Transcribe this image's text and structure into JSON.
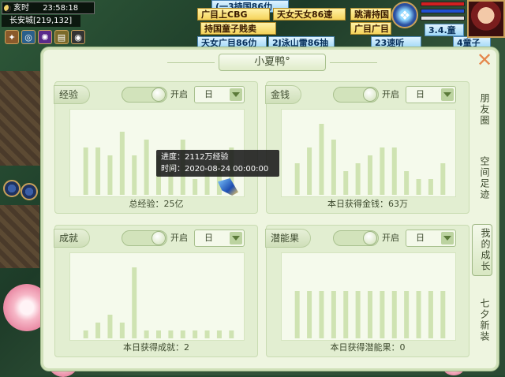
{
  "hud": {
    "time_label": "亥时",
    "clock": "23:58:18",
    "city": "长安城[219,132]"
  },
  "tickers": [
    {
      "text": "(一3持国86仂",
      "style": "blue"
    },
    {
      "text": "广目上CBG",
      "style": "yellow"
    },
    {
      "text": "天女天女86速",
      "style": "yellow"
    },
    {
      "text": "跳清持国",
      "style": "yellow"
    },
    {
      "text": "持国童子贱卖",
      "style": "yellow"
    },
    {
      "text": "广目广目",
      "style": "yellow"
    },
    {
      "text": "天女广目86仂",
      "style": "blue"
    },
    {
      "text": "2J泳山雷86抽",
      "style": "blue"
    },
    {
      "text": "23速听",
      "style": "blue"
    },
    {
      "text": "3.4.童",
      "style": "blue"
    },
    {
      "text": "4童子",
      "style": "blue"
    }
  ],
  "panel": {
    "title": "小夏鸭°",
    "close_label": "✕"
  },
  "side_tabs": [
    {
      "label": "朋友圈",
      "active": false
    },
    {
      "label": "空间足迹",
      "active": false
    },
    {
      "label": "我的成长",
      "active": true
    },
    {
      "label": "七夕新装",
      "active": false
    }
  ],
  "cards": {
    "exp": {
      "tab": "经验",
      "toggle": "开启",
      "period": "日",
      "footer": "总经验：25亿"
    },
    "money": {
      "tab": "金钱",
      "toggle": "开启",
      "period": "日",
      "footer": "本日获得金钱：63万"
    },
    "achievement": {
      "tab": "成就",
      "toggle": "开启",
      "period": "日",
      "footer": "本日获得成就：2"
    },
    "potential": {
      "tab": "潜能果",
      "toggle": "开启",
      "period": "日",
      "footer": "本日获得潜能果：0"
    }
  },
  "tooltip": {
    "line1": "进度：2112万经验",
    "line2": "时间：2020-08-24  00:00:00"
  },
  "chart_data": [
    {
      "id": "exp",
      "type": "bar",
      "values": [
        6,
        6,
        5,
        8,
        5,
        7,
        5,
        4,
        7,
        2,
        3,
        4,
        6
      ]
    },
    {
      "id": "money",
      "type": "bar",
      "values": [
        4,
        6,
        9,
        7,
        3,
        4,
        5,
        6,
        6,
        3,
        2,
        2,
        4
      ]
    },
    {
      "id": "achievement",
      "type": "bar",
      "values": [
        1,
        2,
        3,
        2,
        9,
        1,
        1,
        1,
        1,
        1,
        1,
        1,
        1
      ]
    },
    {
      "id": "potential",
      "type": "bar",
      "values": [
        6,
        6,
        6,
        6,
        6,
        6,
        6,
        6,
        6,
        6,
        6,
        6,
        6
      ]
    }
  ],
  "colors": {
    "bar": "#cfe3b2",
    "panel_bg": "#eef5e0",
    "close": "#e5884d"
  }
}
